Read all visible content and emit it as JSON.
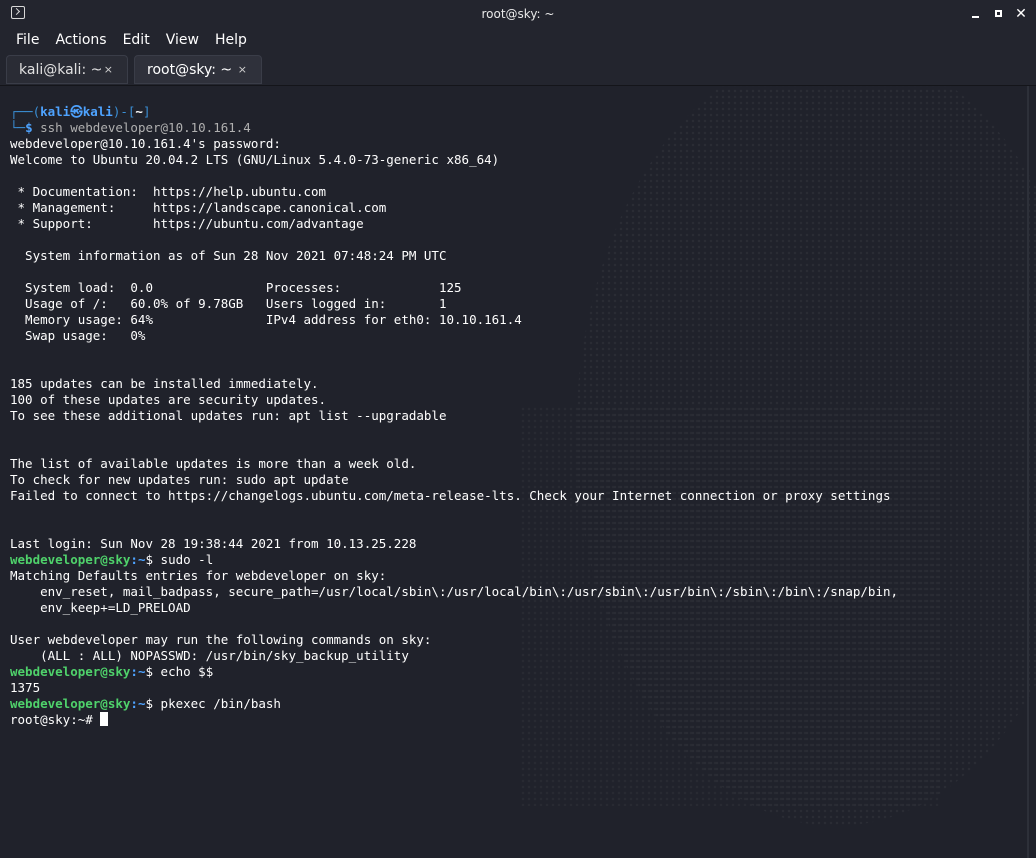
{
  "window": {
    "title": "root@sky: ~"
  },
  "menu": [
    "File",
    "Actions",
    "Edit",
    "View",
    "Help"
  ],
  "tabs": [
    {
      "label": "kali@kali: ~",
      "active": false
    },
    {
      "label": "root@sky: ~",
      "active": true
    }
  ],
  "tab_close_glyph": "×",
  "terminal": {
    "kali_prompt": {
      "open": "┌──(",
      "user": "kali",
      "at": "㉿",
      "host": "kali",
      "close": ")-[",
      "dir": "~",
      "end": "]",
      "arrow": "└─",
      "dollar": "$",
      "command": " ssh webdeveloper@10.10.161.4"
    },
    "output_block_1": [
      "webdeveloper@10.10.161.4's password: ",
      "Welcome to Ubuntu 20.04.2 LTS (GNU/Linux 5.4.0-73-generic x86_64)",
      "",
      " * Documentation:  https://help.ubuntu.com",
      " * Management:     https://landscape.canonical.com",
      " * Support:        https://ubuntu.com/advantage",
      "",
      "  System information as of Sun 28 Nov 2021 07:48:24 PM UTC",
      "",
      "  System load:  0.0               Processes:             125",
      "  Usage of /:   60.0% of 9.78GB   Users logged in:       1",
      "  Memory usage: 64%               IPv4 address for eth0: 10.10.161.4",
      "  Swap usage:   0%",
      "",
      "",
      "185 updates can be installed immediately.",
      "100 of these updates are security updates.",
      "To see these additional updates run: apt list --upgradable",
      "",
      "",
      "The list of available updates is more than a week old.",
      "To check for new updates run: sudo apt update",
      "Failed to connect to https://changelogs.ubuntu.com/meta-release-lts. Check your Internet connection or proxy settings",
      "",
      "",
      "Last login: Sun Nov 28 19:38:44 2021 from 10.13.25.228"
    ],
    "remote_prompt": {
      "user_host": "webdeveloper@sky",
      "path": ":~",
      "dollar": "$ "
    },
    "cmd_sudo": "sudo -l",
    "output_block_2": [
      "Matching Defaults entries for webdeveloper on sky:",
      "    env_reset, mail_badpass, secure_path=/usr/local/sbin\\:/usr/local/bin\\:/usr/sbin\\:/usr/bin\\:/sbin\\:/bin\\:/snap/bin,",
      "    env_keep+=LD_PRELOAD",
      "",
      "User webdeveloper may run the following commands on sky:",
      "    (ALL : ALL) NOPASSWD: /usr/bin/sky_backup_utility"
    ],
    "cmd_echo": "echo $$",
    "echo_output": "1375",
    "cmd_pkexec": "pkexec /bin/bash",
    "root_prompt": "root@sky:~# "
  }
}
